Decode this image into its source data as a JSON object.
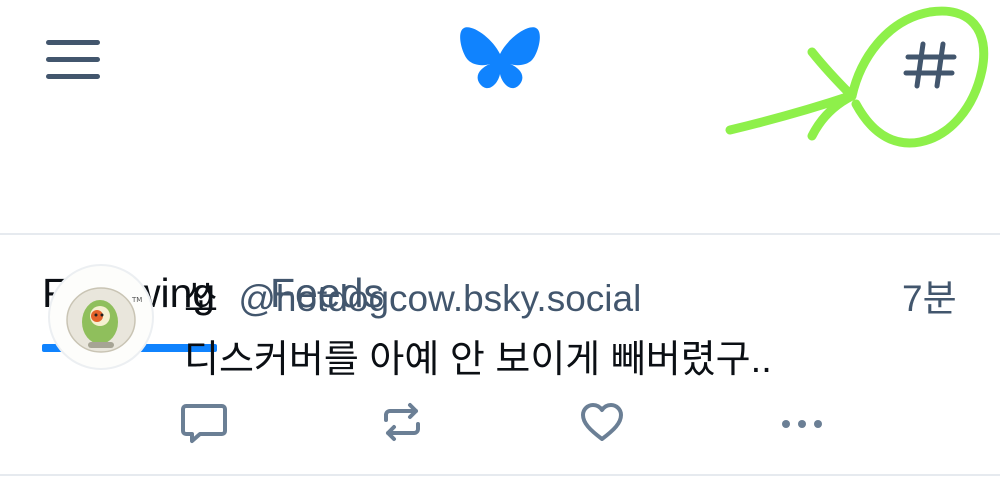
{
  "header": {
    "menu_icon": "hamburger-menu-icon",
    "logo_icon": "butterfly-logo-icon",
    "feeds_icon": "hashtag-icon"
  },
  "tabs": [
    {
      "label": "Following",
      "active": true
    },
    {
      "label": "Feeds",
      "active": false
    }
  ],
  "post": {
    "display_name": "쏘",
    "handle": "@hotdogcow.bsky.social",
    "timestamp": "7분",
    "text": "디스커버를 아예 안 보이게 빼버렸구..",
    "actions": [
      "reply-icon",
      "repost-icon",
      "like-icon",
      "more-icon"
    ]
  },
  "colors": {
    "accent": "#1083fe",
    "text_primary": "#0b0f14",
    "text_secondary": "#42566d",
    "annotation": "#8ef04a"
  }
}
